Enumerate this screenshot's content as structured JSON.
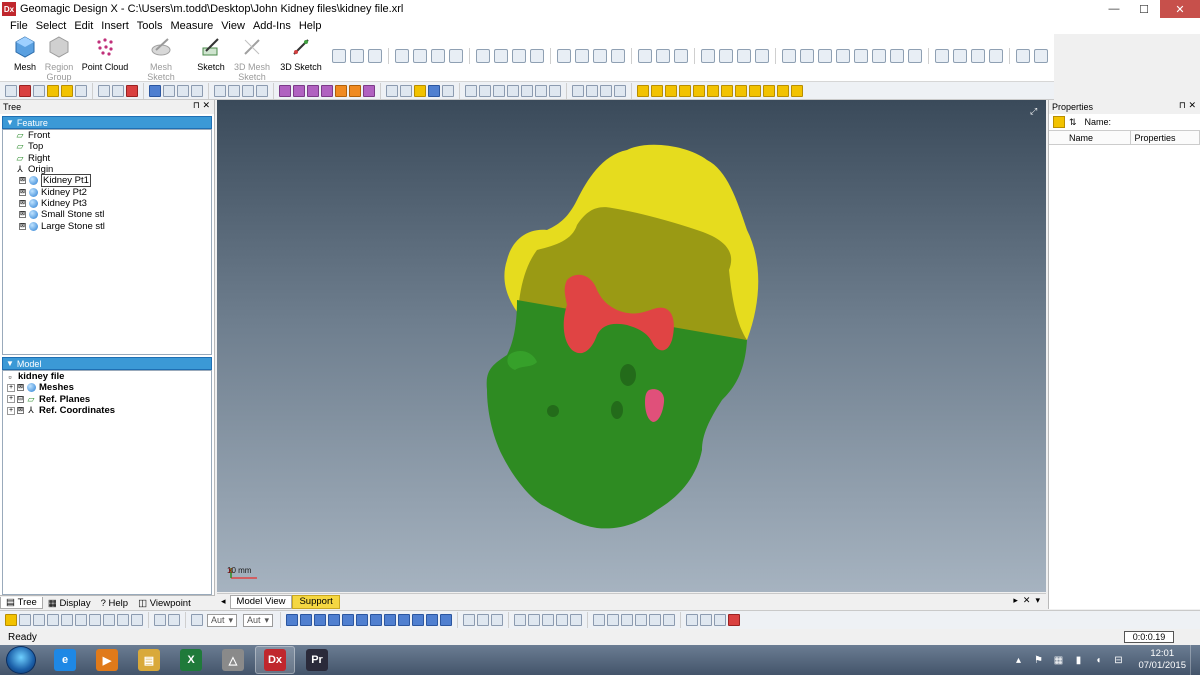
{
  "window": {
    "title": "Geomagic Design X - C:\\Users\\m.todd\\Desktop\\John Kidney files\\kidney file.xrl",
    "logo": "Dx",
    "min": "—",
    "max": "☐",
    "close": "✕"
  },
  "menu": [
    "File",
    "Select",
    "Edit",
    "Insert",
    "Tools",
    "Measure",
    "View",
    "Add-Ins",
    "Help"
  ],
  "ribbon": {
    "mesh": "Mesh",
    "region_group_1": "Region",
    "region_group_2": "Group",
    "point_cloud": "Point Cloud",
    "mesh_sketch": "Mesh Sketch",
    "sketch": "Sketch",
    "mesh_3d_1": "3D Mesh",
    "mesh_3d_2": "Sketch",
    "sketch_3d": "3D Sketch"
  },
  "tree_panel": {
    "title": "Tree",
    "pin": "⊓",
    "close": "✕",
    "feature_header": "Feature",
    "feature_items": [
      {
        "label": "Front",
        "icon": "plane-icon"
      },
      {
        "label": "Top",
        "icon": "plane-icon"
      },
      {
        "label": "Right",
        "icon": "plane-icon"
      },
      {
        "label": "Origin",
        "icon": "axis-icon"
      },
      {
        "label": "Kidney Pt1",
        "icon": "mesh-sphere-icon"
      },
      {
        "label": "Kidney Pt2",
        "icon": "mesh-sphere-icon"
      },
      {
        "label": "Kidney Pt3",
        "icon": "mesh-sphere-icon"
      },
      {
        "label": "Small Stone stl",
        "icon": "mesh-sphere-icon"
      },
      {
        "label": "Large Stone stl",
        "icon": "mesh-sphere-icon"
      }
    ],
    "model_header": "Model",
    "model_root": "kidney file",
    "model_items": [
      {
        "label": "Meshes",
        "icon": "mesh-sphere-icon"
      },
      {
        "label": "Ref. Planes",
        "icon": "plane-icon"
      },
      {
        "label": "Ref. Coordinates",
        "icon": "axis-icon"
      }
    ],
    "tabs": [
      "Tree",
      "Display",
      "Help",
      "Viewpoint"
    ]
  },
  "viewport": {
    "scale_label": "10 mm",
    "axis_label": "X",
    "colors": {
      "yellow": "#e6dc1e",
      "olive": "#9a9a14",
      "green": "#2e8b22",
      "red": "#e04444",
      "pink": "#e0507a"
    }
  },
  "view_tabs": {
    "model_view": "Model View",
    "support": "Support"
  },
  "properties": {
    "title": "Properties",
    "name_label": "Name:",
    "col_name": "Name",
    "col_properties": "Properties"
  },
  "bottom_toolbar": {
    "combo1": "Aut",
    "combo2": "Aut"
  },
  "status": {
    "text": "Ready",
    "timer": "0:0:0.19"
  },
  "taskbar": {
    "apps": [
      {
        "name": "Internet Explorer",
        "icon": "ie-icon",
        "glyph": "e",
        "color": "#1e88e5"
      },
      {
        "name": "Media",
        "icon": "media-icon",
        "glyph": "▶",
        "color": "#e07a1a"
      },
      {
        "name": "Explorer",
        "icon": "folder-icon",
        "glyph": "▤",
        "color": "#d9a93a"
      },
      {
        "name": "Excel",
        "icon": "excel-icon",
        "glyph": "X",
        "color": "#1f7a3a"
      },
      {
        "name": "Geomagic",
        "icon": "geomagic-icon",
        "glyph": "△",
        "color": "#8a8a8a"
      },
      {
        "name": "Design X",
        "icon": "designx-icon",
        "glyph": "Dx",
        "color": "#c0272d"
      },
      {
        "name": "Premiere",
        "icon": "premiere-icon",
        "glyph": "Pr",
        "color": "#2a2a3a"
      }
    ],
    "time": "12:01",
    "date": "07/01/2015"
  }
}
